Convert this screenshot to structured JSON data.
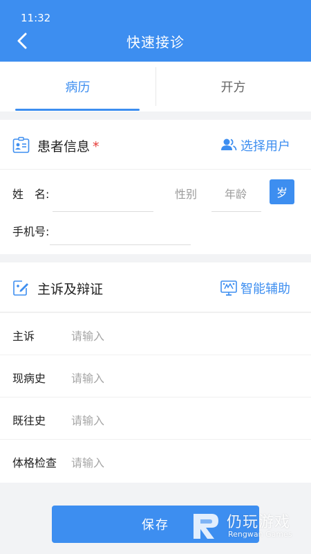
{
  "status_bar": {
    "time": "11:32"
  },
  "header": {
    "title": "快速接诊",
    "back_icon": "chevron-left-icon"
  },
  "tabs": [
    {
      "label": "病历",
      "active": true
    },
    {
      "label": "开方",
      "active": false
    }
  ],
  "patient_section": {
    "title": "患者信息",
    "required_mark": "*",
    "action_label": "选择用户",
    "action_icon": "users-icon",
    "name_label": "姓　名:",
    "gender_placeholder": "性别",
    "age_placeholder": "年龄",
    "age_unit": "岁",
    "phone_label": "手机号:"
  },
  "complaint_section": {
    "title": "主诉及辩证",
    "action_label": "智能辅助",
    "action_icon": "smart-assist-icon",
    "fields": [
      {
        "label": "主诉",
        "placeholder": "请输入"
      },
      {
        "label": "现病史",
        "placeholder": "请输入"
      },
      {
        "label": "既往史",
        "placeholder": "请输入"
      },
      {
        "label": "体格检查",
        "placeholder": "请输入"
      }
    ]
  },
  "footer": {
    "save_label": "保存"
  },
  "watermark": {
    "name_cn": "仍玩游戏",
    "name_en": "Rengwan Games"
  },
  "colors": {
    "primary": "#3d8ef0",
    "required": "#e53935",
    "background": "#f2f3f5"
  }
}
